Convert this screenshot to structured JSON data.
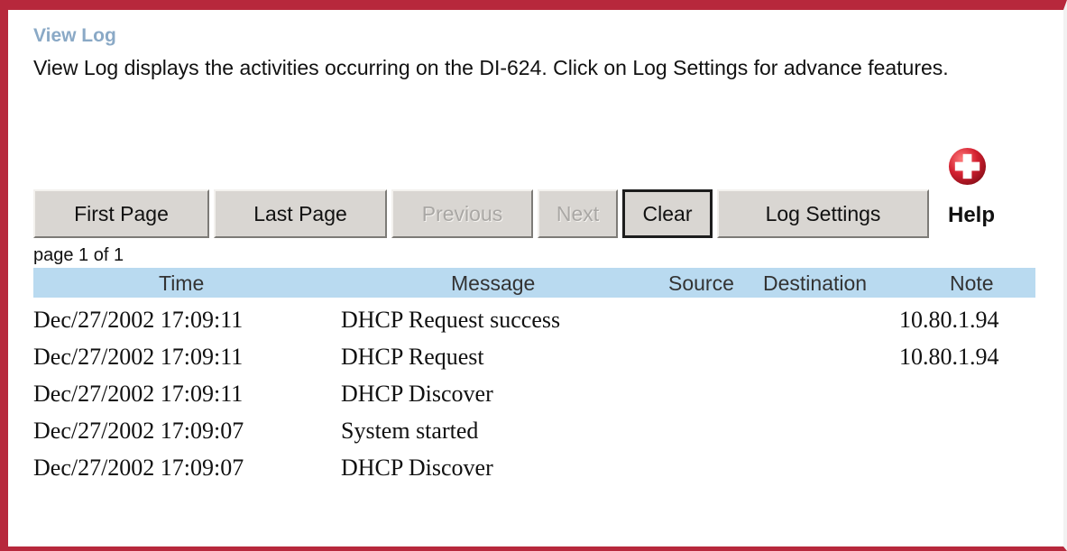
{
  "page": {
    "title": "View Log",
    "description": "View Log displays the activities occurring on the DI-624. Click on Log Settings for advance features."
  },
  "toolbar": {
    "first_page": "First Page",
    "last_page": "Last Page",
    "previous": "Previous",
    "next": "Next",
    "clear": "Clear",
    "log_settings": "Log Settings",
    "help": "Help"
  },
  "pagination": {
    "text": "page 1 of 1",
    "current": 1,
    "total": 1
  },
  "log": {
    "columns": [
      "Time",
      "Message",
      "Source",
      "Destination",
      "Note"
    ],
    "rows": [
      {
        "time": "Dec/27/2002 17:09:11",
        "message": "DHCP Request success",
        "note": "10.80.1.94"
      },
      {
        "time": "Dec/27/2002 17:09:11",
        "message": "DHCP Request",
        "note": "10.80.1.94"
      },
      {
        "time": "Dec/27/2002 17:09:11",
        "message": "DHCP Discover",
        "note": ""
      },
      {
        "time": "Dec/27/2002 17:09:07",
        "message": "System started",
        "note": ""
      },
      {
        "time": "Dec/27/2002 17:09:07",
        "message": "DHCP Discover",
        "note": ""
      }
    ]
  },
  "colors": {
    "frame": "#b7283c",
    "title": "#8aa9c6",
    "header_bg": "#b9daf0",
    "button_bg": "#d9d6d2",
    "help_icon": "#c8202c"
  },
  "icons": {
    "help": "plus-circle-icon"
  }
}
